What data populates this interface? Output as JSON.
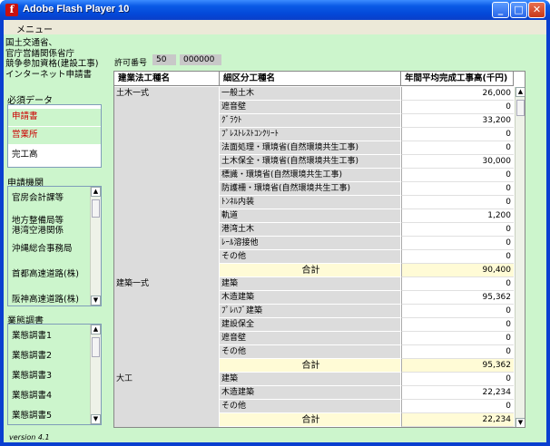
{
  "window": {
    "title": "Adobe Flash Player 10",
    "min": "_",
    "max": "□",
    "close": "✕"
  },
  "menu": {
    "item": "メニュー"
  },
  "header": {
    "org_title": "国土交通省、\n官庁営繕関係省庁\n競争参加資格(建設工事)\nインターネット申請書"
  },
  "required_data": {
    "label": "必須データ",
    "items": [
      {
        "label": "申請書",
        "color": "#cc0000",
        "bg": "#ccf5cc"
      },
      {
        "label": "営業所",
        "color": "#cc0000",
        "bg": "#ccf5cc"
      },
      {
        "label": "完工高",
        "color": "#000000",
        "bg": "#ffffff"
      }
    ]
  },
  "agencies": {
    "label": "申請機関",
    "items": [
      {
        "label": "官房会計課等"
      },
      {
        "label": "地方整備局等\n港湾空港関係"
      },
      {
        "label": "沖縄総合事務局"
      },
      {
        "label": "首都高速道路(株)"
      },
      {
        "label": "阪神高速道路(株)"
      }
    ]
  },
  "surveys": {
    "label": "業態調書",
    "items": [
      {
        "label": "業態調書1"
      },
      {
        "label": "業態調書2"
      },
      {
        "label": "業態調書3"
      },
      {
        "label": "業態調書4"
      },
      {
        "label": "業態調書5"
      }
    ]
  },
  "permit": {
    "label": "許可番号",
    "value1": "50",
    "value2": "000000"
  },
  "table": {
    "headers": [
      "建業法工種名",
      "細区分工種名",
      "年間平均完成工事高(千円)"
    ],
    "rows": [
      {
        "type": "土木一式",
        "sub": "一般土木",
        "amount": "26,000"
      },
      {
        "type": "",
        "sub": "遮音壁",
        "amount": "0"
      },
      {
        "type": "",
        "sub": "ｸﾞﾗｳﾄ",
        "amount": "33,200"
      },
      {
        "type": "",
        "sub": "ﾌﾟﾚｽﾄﾚｽﾄｺﾝｸﾘｰﾄ",
        "amount": "0"
      },
      {
        "type": "",
        "sub": "法面処理・環境省(自然環境共生工事)",
        "amount": "0"
      },
      {
        "type": "",
        "sub": "土木保全・環境省(自然環境共生工事)",
        "amount": "30,000"
      },
      {
        "type": "",
        "sub": "標識・環境省(自然環境共生工事)",
        "amount": "0"
      },
      {
        "type": "",
        "sub": "防護柵・環境省(自然環境共生工事)",
        "amount": "0"
      },
      {
        "type": "",
        "sub": "ﾄﾝﾈﾙ内装",
        "amount": "0"
      },
      {
        "type": "",
        "sub": "軌道",
        "amount": "1,200"
      },
      {
        "type": "",
        "sub": "港湾土木",
        "amount": "0"
      },
      {
        "type": "",
        "sub": "ﾚｰﾙ溶接他",
        "amount": "0"
      },
      {
        "type": "",
        "sub": "その他",
        "amount": "0"
      },
      {
        "type": "",
        "sub": "合計",
        "amount": "90,400",
        "total": true
      },
      {
        "type": "建築一式",
        "sub": "建築",
        "amount": "0"
      },
      {
        "type": "",
        "sub": "木造建築",
        "amount": "95,362"
      },
      {
        "type": "",
        "sub": "ﾌﾟﾚﾊﾌﾞ建築",
        "amount": "0"
      },
      {
        "type": "",
        "sub": "建設保全",
        "amount": "0"
      },
      {
        "type": "",
        "sub": "遮音壁",
        "amount": "0"
      },
      {
        "type": "",
        "sub": "その他",
        "amount": "0"
      },
      {
        "type": "",
        "sub": "合計",
        "amount": "95,362",
        "total": true
      },
      {
        "type": "大工",
        "sub": "建築",
        "amount": "0"
      },
      {
        "type": "",
        "sub": "木造建築",
        "amount": "22,234"
      },
      {
        "type": "",
        "sub": "その他",
        "amount": "0"
      },
      {
        "type": "",
        "sub": "合計",
        "amount": "22,234",
        "total": true
      }
    ]
  },
  "footer": {
    "version": "version 4.1"
  }
}
